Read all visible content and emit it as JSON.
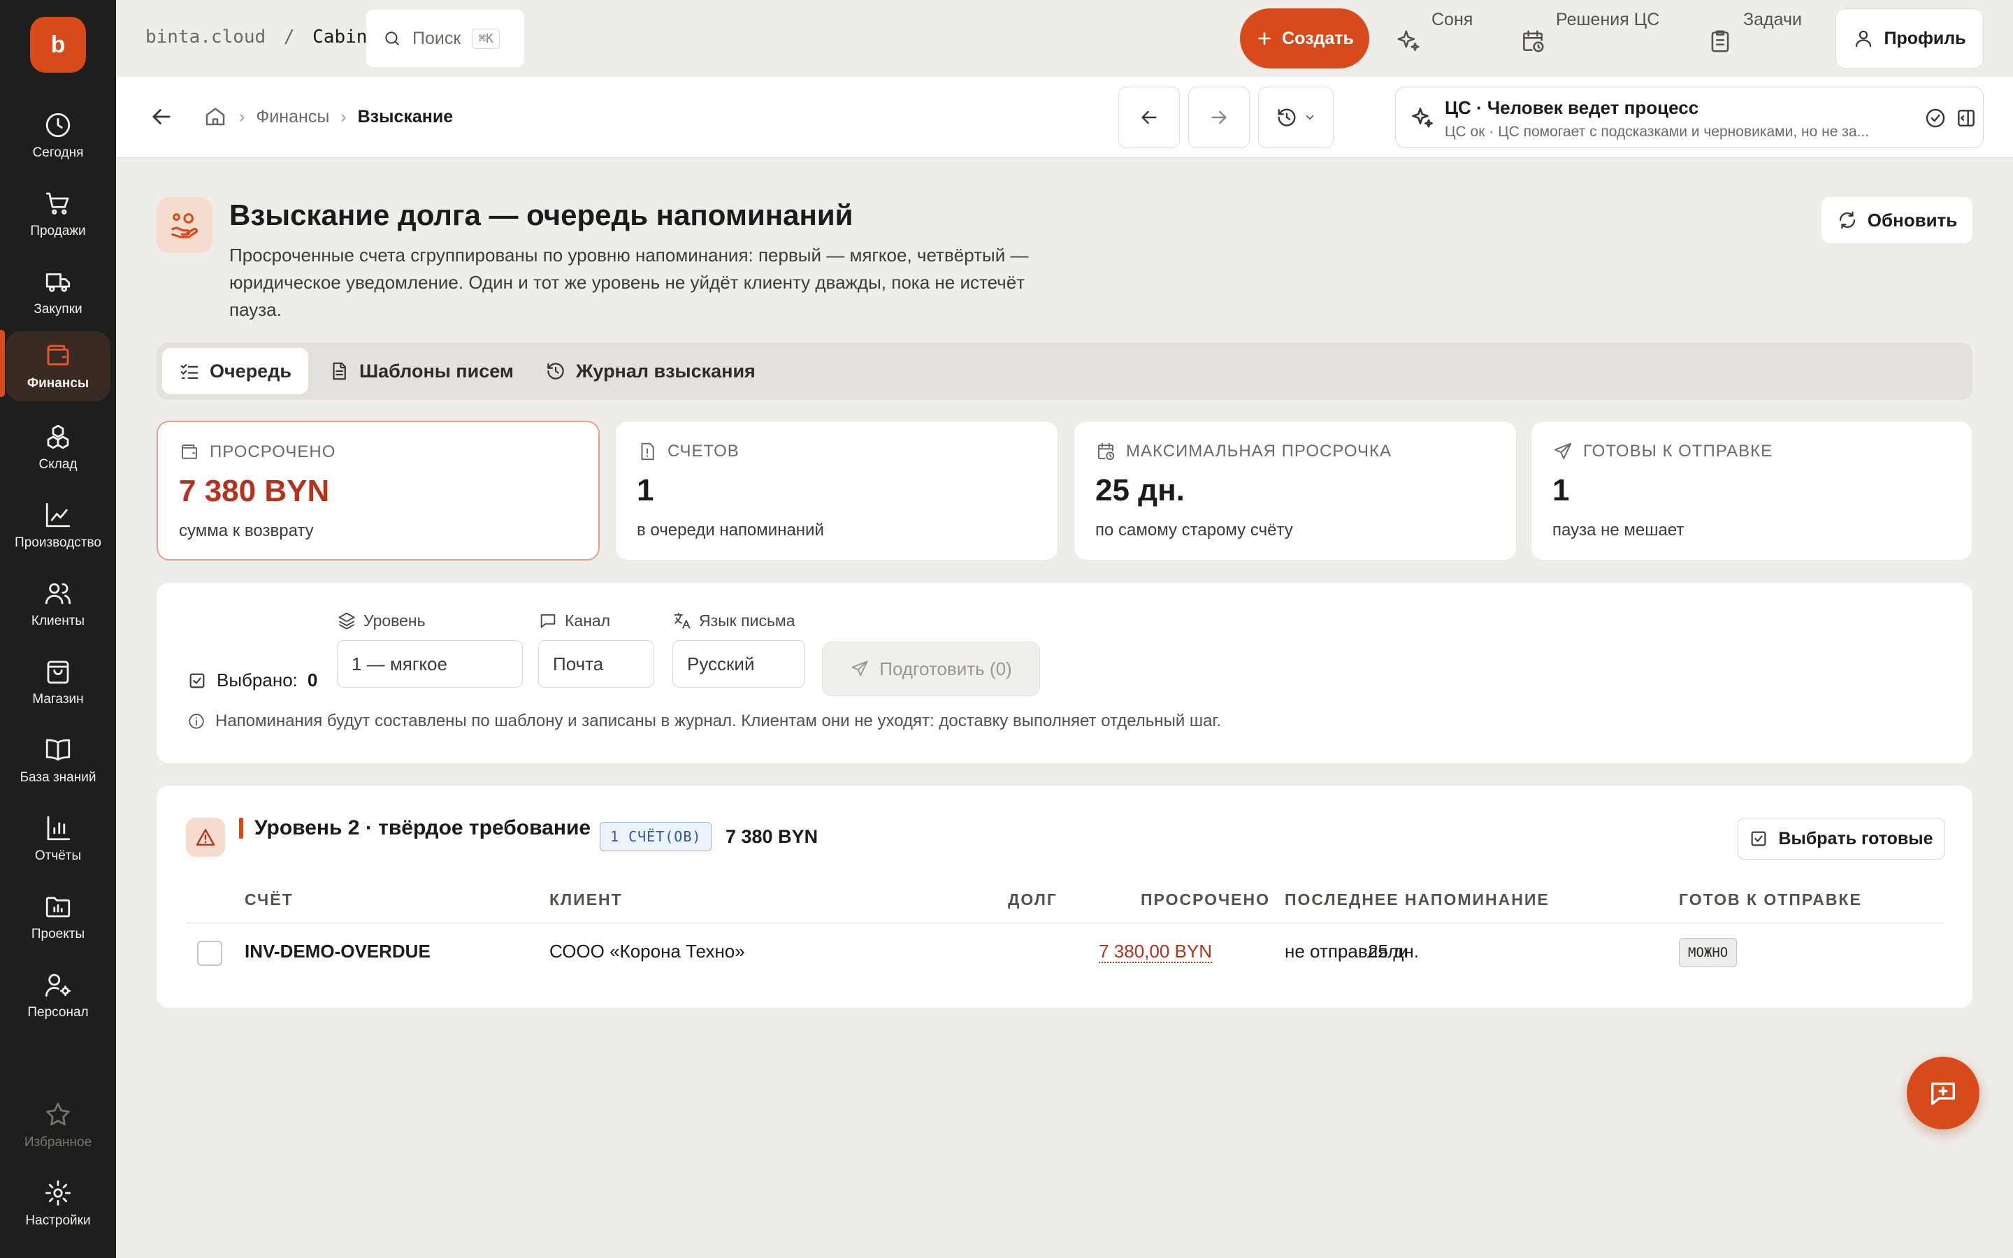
{
  "app": {
    "logo_letter": "b",
    "brand_color": "#d94a1a"
  },
  "topbar": {
    "workspace": "binta.cloud",
    "separator": "/",
    "section": "Cabinet",
    "search_placeholder": "Поиск",
    "search_shortcut": "⌘K",
    "create_label": "Создать",
    "assistant_label": "Соня",
    "decisions_label": "Решения ЦС",
    "tasks_label": "Задачи",
    "profile_label": "Профиль"
  },
  "sidebar": {
    "items": [
      {
        "label": "Сегодня",
        "icon": "clock-icon"
      },
      {
        "label": "Продажи",
        "icon": "cart-icon"
      },
      {
        "label": "Закупки",
        "icon": "truck-icon"
      },
      {
        "label": "Финансы",
        "icon": "wallet-icon",
        "active": true
      },
      {
        "label": "Склад",
        "icon": "boxes-icon"
      },
      {
        "label": "Производство",
        "icon": "factory-icon"
      },
      {
        "label": "Клиенты",
        "icon": "users-icon"
      },
      {
        "label": "Магазин",
        "icon": "bag-icon"
      },
      {
        "label": "База знаний",
        "icon": "book-icon"
      },
      {
        "label": "Отчёты",
        "icon": "bar-chart-icon"
      },
      {
        "label": "Проекты",
        "icon": "folder-chart-icon"
      },
      {
        "label": "Персонал",
        "icon": "user-gear-icon"
      }
    ],
    "favorites_label": "Избранное",
    "settings_label": "Настройки"
  },
  "subheader": {
    "breadcrumb": [
      "Финансы",
      "Взыскание"
    ],
    "ai_title": "ЦС · Человек ведет процесс",
    "ai_subtitle": "ЦС ок · ЦС помогает с подсказками и черновиками, но не за..."
  },
  "page": {
    "title": "Взыскание долга — очередь напоминаний",
    "description": "Просроченные счета сгруппированы по уровню напоминания: первый — мягкое, четвёртый — юридическое уведомление. Один и тот же уровень не уйдёт клиенту дважды, пока не истечёт пауза.",
    "refresh_label": "Обновить"
  },
  "tabs": [
    {
      "label": "Очередь",
      "icon": "list-check-icon",
      "active": true
    },
    {
      "label": "Шаблоны писем",
      "icon": "document-icon"
    },
    {
      "label": "Журнал взыскания",
      "icon": "history-icon"
    }
  ],
  "stats": [
    {
      "caption": "ПРОСРОЧЕНО",
      "value": "7 380 BYN",
      "note": "сумма к возврату",
      "icon": "wallet-icon",
      "highlight": true
    },
    {
      "caption": "СЧЕТОВ",
      "value": "1",
      "note": "в очереди напоминаний",
      "icon": "file-alert-icon"
    },
    {
      "caption": "МАКСИМАЛЬНАЯ ПРОСРОЧКА",
      "value": "25 дн.",
      "note": "по самому старому счёту",
      "icon": "calendar-clock-icon"
    },
    {
      "caption": "ГОТОВЫ К ОТПРАВКЕ",
      "value": "1",
      "note": "пауза не мешает",
      "icon": "send-icon"
    }
  ],
  "filters": {
    "selected_label": "Выбрано:",
    "selected_count": "0",
    "level_label": "Уровень",
    "level_value": "1 — мягкое",
    "channel_label": "Канал",
    "channel_value": "Почта",
    "language_label": "Язык письма",
    "language_value": "Русский",
    "prepare_label": "Подготовить (0)",
    "info_text": "Напоминания будут составлены по шаблону и записаны в журнал. Клиентам они не уходят: доставку выполняет отдельный шаг."
  },
  "group": {
    "title": "Уровень 2 · твёрдое требование",
    "count_badge": "1 СЧЁТ(ОВ)",
    "sum": "7 380 BYN",
    "pick_ready_label": "Выбрать готовые",
    "columns": [
      "СЧЁТ",
      "КЛИЕНТ",
      "ДОЛГ",
      "ПРОСРОЧЕНО",
      "ПОСЛЕДНЕЕ НАПОМИНАНИЕ",
      "ГОТОВ К ОТПРАВКЕ"
    ],
    "rows": [
      {
        "invoice": "INV-DEMO-OVERDUE",
        "client": "СООО «Корона Техно»",
        "debt": "7 380,00 BYN",
        "overdue": "25 дн.",
        "last_reminder": "не отправляли",
        "ready": "можно"
      }
    ]
  }
}
